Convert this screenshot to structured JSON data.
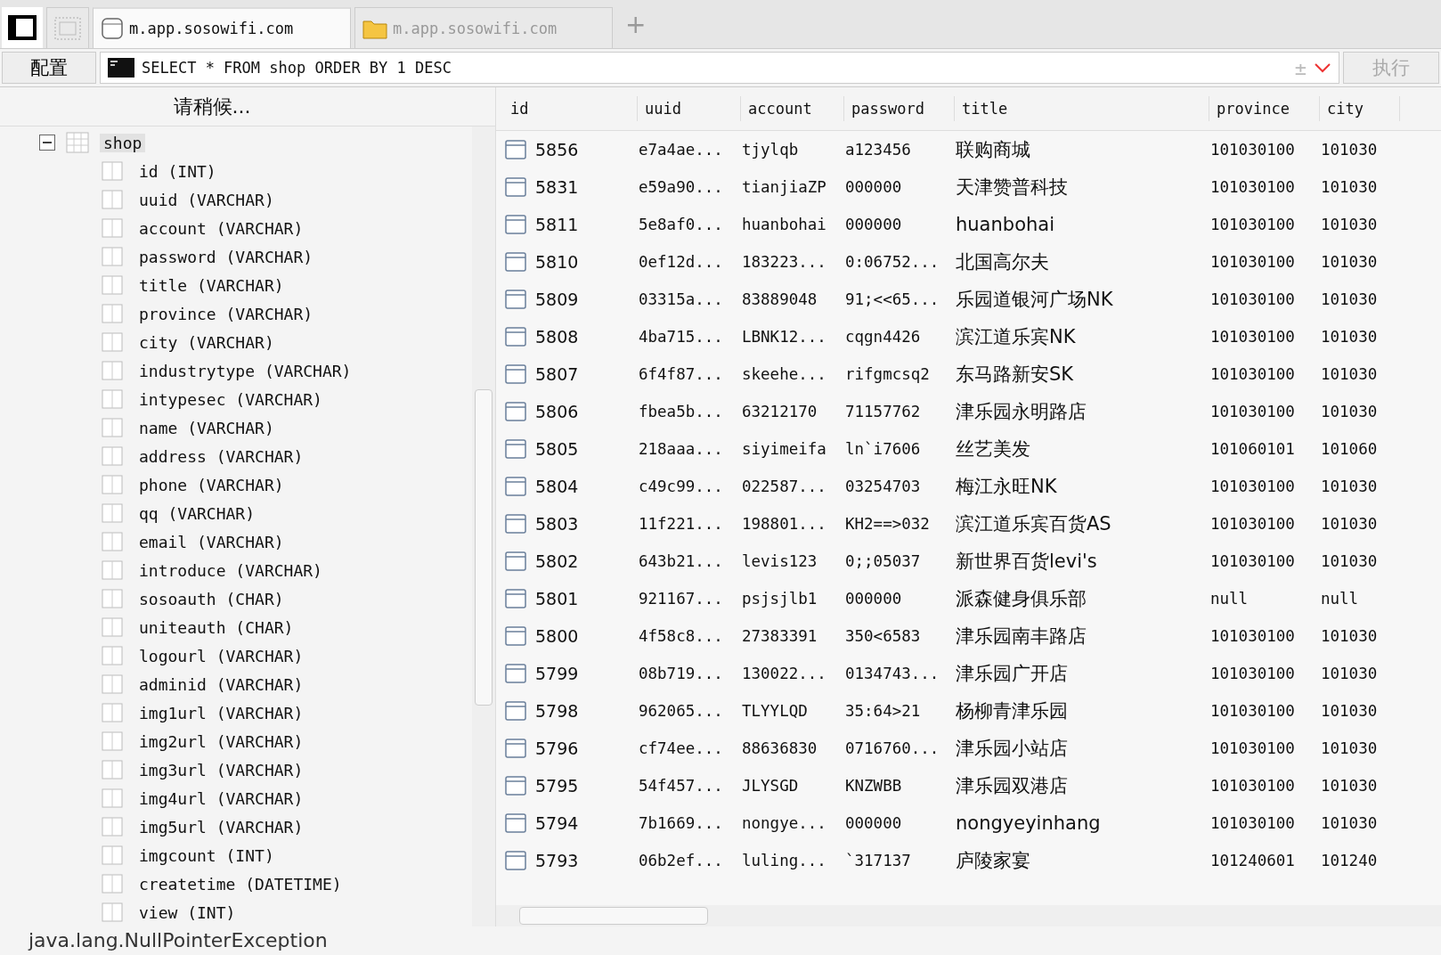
{
  "tabs": [
    {
      "kind": "window",
      "selected": false
    },
    {
      "kind": "blank",
      "selected": false
    },
    {
      "kind": "database",
      "label": "m.app.sosowifi.com",
      "selected": true
    },
    {
      "kind": "folder",
      "label": "m.app.sosowifi.com",
      "selected": false
    }
  ],
  "new_tab": "+",
  "toolbar": {
    "config_button": "配置",
    "query": "SELECT * FROM shop ORDER BY 1 DESC",
    "toggle": "±",
    "execute": {
      "label": "执行",
      "disabled": true
    }
  },
  "sidebar": {
    "header": "请稍候...",
    "tree": [
      {
        "label": "shop",
        "expanded": true,
        "selected": true,
        "children": [
          {
            "label": "id (INT)",
            "selected": false
          },
          {
            "label": "uuid (VARCHAR)",
            "selected": false
          },
          {
            "label": "account (VARCHAR)",
            "selected": false
          },
          {
            "label": "password (VARCHAR)",
            "selected": false
          },
          {
            "label": "title (VARCHAR)",
            "selected": false
          },
          {
            "label": "province (VARCHAR)",
            "selected": false
          },
          {
            "label": "city (VARCHAR)",
            "selected": false
          },
          {
            "label": "industrytype (VARCHAR)",
            "selected": false
          },
          {
            "label": "intypesec (VARCHAR)",
            "selected": false
          },
          {
            "label": "name (VARCHAR)",
            "selected": false
          },
          {
            "label": "address (VARCHAR)",
            "selected": false
          },
          {
            "label": "phone (VARCHAR)",
            "selected": false
          },
          {
            "label": "qq (VARCHAR)",
            "selected": false
          },
          {
            "label": "email (VARCHAR)",
            "selected": false
          },
          {
            "label": "introduce (VARCHAR)",
            "selected": false
          },
          {
            "label": "sosoauth (CHAR)",
            "selected": false
          },
          {
            "label": "uniteauth (CHAR)",
            "selected": false
          },
          {
            "label": "logourl (VARCHAR)",
            "selected": false
          },
          {
            "label": "adminid (VARCHAR)",
            "selected": false
          },
          {
            "label": "img1url (VARCHAR)",
            "selected": false
          },
          {
            "label": "img2url (VARCHAR)",
            "selected": false
          },
          {
            "label": "img3url (VARCHAR)",
            "selected": false
          },
          {
            "label": "img4url (VARCHAR)",
            "selected": false
          },
          {
            "label": "img5url (VARCHAR)",
            "selected": false
          },
          {
            "label": "imgcount (INT)",
            "selected": false
          },
          {
            "label": "createtime (DATETIME)",
            "selected": false
          },
          {
            "label": "view (INT)",
            "selected": false
          }
        ]
      }
    ]
  },
  "table": {
    "columns": [
      "id",
      "uuid",
      "account",
      "password",
      "title",
      "province",
      "city"
    ],
    "rows": [
      [
        "5856",
        "e7a4ae...",
        "tjylqb",
        "a123456",
        "联购商城",
        "101030100",
        "101030"
      ],
      [
        "5831",
        "e59a90...",
        "tianjiaZP",
        "000000",
        "天津赞普科技",
        "101030100",
        "101030"
      ],
      [
        "5811",
        "5e8af0...",
        "huanbohai",
        "000000",
        "huanbohai",
        "101030100",
        "101030"
      ],
      [
        "5810",
        "0ef12d...",
        "183223...",
        "0:06752...",
        "北国高尔夫",
        "101030100",
        "101030"
      ],
      [
        "5809",
        "03315a...",
        "83889048",
        "91;<<65...",
        "乐园道银河广场NK",
        "101030100",
        "101030"
      ],
      [
        "5808",
        "4ba715...",
        "LBNK12...",
        "cqgn4426",
        "滨江道乐宾NK",
        "101030100",
        "101030"
      ],
      [
        "5807",
        "6f4f87...",
        "skeehe...",
        "rifgmcsq2",
        "东马路新安SK",
        "101030100",
        "101030"
      ],
      [
        "5806",
        "fbea5b...",
        "63212170",
        "71157762",
        "津乐园永明路店",
        "101030100",
        "101030"
      ],
      [
        "5805",
        "218aaa...",
        "siyimeifa",
        "ln`i7606",
        "丝艺美发",
        "101060101",
        "101060"
      ],
      [
        "5804",
        "c49c99...",
        "022587...",
        "03254703",
        "梅江永旺NK",
        "101030100",
        "101030"
      ],
      [
        "5803",
        "11f221...",
        "198801...",
        "KH2==>032",
        "滨江道乐宾百货AS",
        "101030100",
        "101030"
      ],
      [
        "5802",
        "643b21...",
        "levis123",
        "0;;05037",
        "新世界百货levi's",
        "101030100",
        "101030"
      ],
      [
        "5801",
        "921167...",
        "psjsjlb1",
        "000000",
        "派森健身俱乐部",
        "null",
        "null"
      ],
      [
        "5800",
        "4f58c8...",
        "27383391",
        "350<6583",
        "津乐园南丰路店",
        "101030100",
        "101030"
      ],
      [
        "5799",
        "08b719...",
        "130022...",
        "0134743...",
        "津乐园广开店",
        "101030100",
        "101030"
      ],
      [
        "5798",
        "962065...",
        "TLYYLQD",
        "35:64>21",
        "杨柳青津乐园",
        "101030100",
        "101030"
      ],
      [
        "5796",
        "cf74ee...",
        "88636830",
        "0716760...",
        "津乐园小站店",
        "101030100",
        "101030"
      ],
      [
        "5795",
        "54f457...",
        "JLYSGD",
        "KNZWBB",
        "津乐园双港店",
        "101030100",
        "101030"
      ],
      [
        "5794",
        "7b1669...",
        "nongye...",
        "000000",
        "nongyeyinhang",
        "101030100",
        "101030"
      ],
      [
        "5793",
        "06b2ef...",
        "luling...",
        "`317137",
        "庐陵家宴",
        "101240601",
        "101240"
      ]
    ]
  },
  "status_bar": "java.lang.NullPointerException"
}
